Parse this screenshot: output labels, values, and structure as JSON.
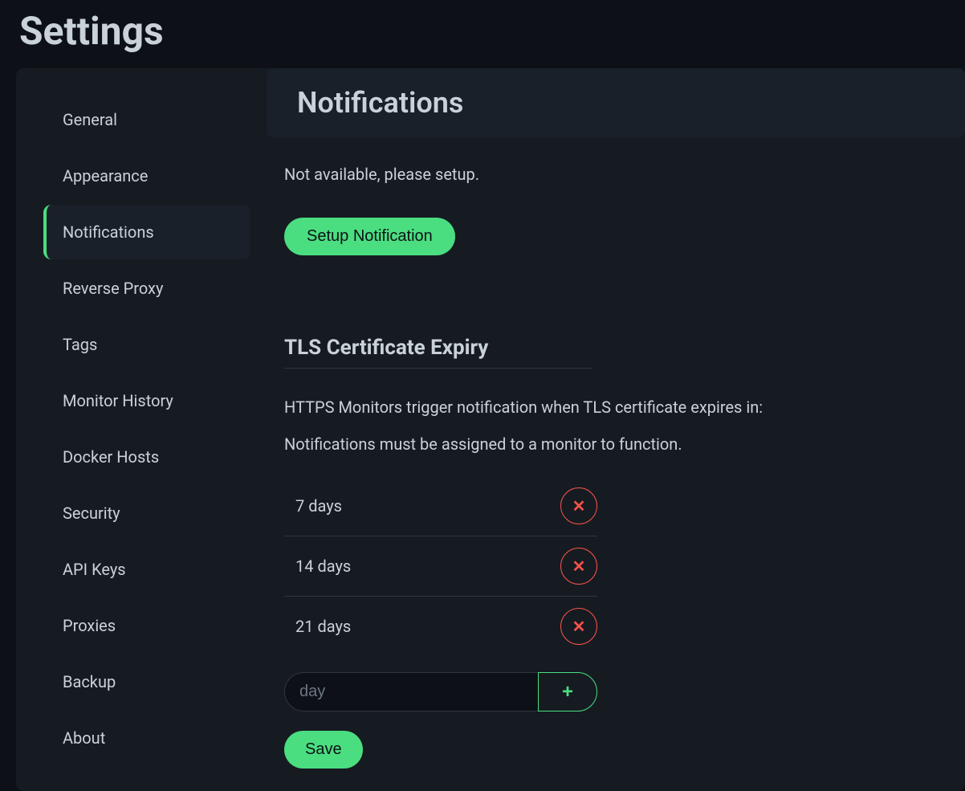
{
  "page": {
    "title": "Settings"
  },
  "sidebar": {
    "items": [
      {
        "label": "General"
      },
      {
        "label": "Appearance"
      },
      {
        "label": "Notifications"
      },
      {
        "label": "Reverse Proxy"
      },
      {
        "label": "Tags"
      },
      {
        "label": "Monitor History"
      },
      {
        "label": "Docker Hosts"
      },
      {
        "label": "Security"
      },
      {
        "label": "API Keys"
      },
      {
        "label": "Proxies"
      },
      {
        "label": "Backup"
      },
      {
        "label": "About"
      }
    ],
    "activeIndex": 2
  },
  "content": {
    "heading": "Notifications",
    "not_available_msg": "Not available, please setup.",
    "setup_button": "Setup Notification",
    "tls": {
      "title": "TLS Certificate Expiry",
      "desc1": "HTTPS Monitors trigger notification when TLS certificate expires in:",
      "desc2": "Notifications must be assigned to a monitor to function.",
      "items": [
        {
          "label": "7 days"
        },
        {
          "label": "14 days"
        },
        {
          "label": "21 days"
        }
      ],
      "input_placeholder": "day",
      "save_label": "Save"
    }
  }
}
